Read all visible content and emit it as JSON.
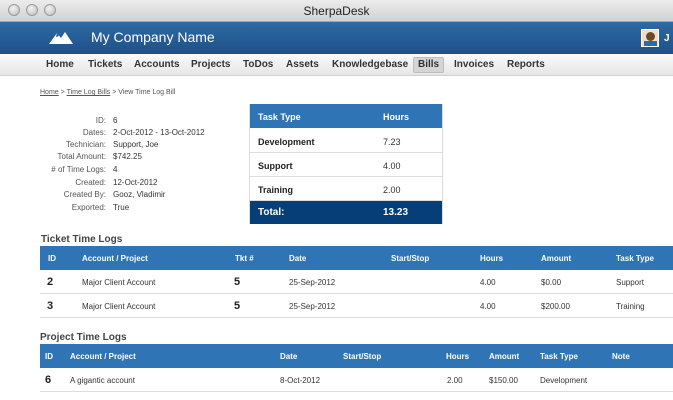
{
  "window": {
    "title": "SherpaDesk"
  },
  "header": {
    "company": "My Company Name",
    "user_initial": "J"
  },
  "nav": [
    "Home",
    "Tickets",
    "Accounts",
    "Projects",
    "ToDos",
    "Assets",
    "Knowledgebase",
    "Bills",
    "Invoices",
    "Reports"
  ],
  "nav_active": "Bills",
  "breadcrumb": {
    "home": "Home",
    "sep1": ">",
    "bills": "Time Log Bills",
    "sep2": ">",
    "current": "View Time Log Bill"
  },
  "details": [
    {
      "label": "ID:",
      "value": "6"
    },
    {
      "label": "Dates:",
      "value": "2-Oct-2012 - 13-Oct-2012"
    },
    {
      "label": "Technician:",
      "value": "Support, Joe"
    },
    {
      "label": "Total Amount:",
      "value": "$742.25"
    },
    {
      "label": "# of Time Logs:",
      "value": "4"
    },
    {
      "label": "Created:",
      "value": "12-Oct-2012"
    },
    {
      "label": "Created By:",
      "value": "Gooz, Vladimir"
    },
    {
      "label": "Exported:",
      "value": "True"
    }
  ],
  "summary": {
    "headers": {
      "type": "Task Type",
      "hours": "Hours"
    },
    "rows": [
      {
        "type": "Development",
        "hours": "7.23"
      },
      {
        "type": "Support",
        "hours": "4.00"
      },
      {
        "type": "Training",
        "hours": "2.00"
      }
    ],
    "total_label": "Total:",
    "total_hours": "13.23"
  },
  "ticket_logs": {
    "title": "Ticket Time Logs",
    "headers": {
      "id": "ID",
      "account": "Account / Project",
      "tkt": "Tkt #",
      "date": "Date",
      "startstop": "Start/Stop",
      "hours": "Hours",
      "amount": "Amount",
      "task": "Task Type"
    },
    "rows": [
      {
        "id": "2",
        "account": "Major Client Account",
        "tkt": "5",
        "date": "25-Sep-2012",
        "startstop": "",
        "hours": "4.00",
        "amount": "$0.00",
        "task": "Support"
      },
      {
        "id": "3",
        "account": "Major Client Account",
        "tkt": "5",
        "date": "25-Sep-2012",
        "startstop": "",
        "hours": "4.00",
        "amount": "$200.00",
        "task": "Training"
      }
    ]
  },
  "project_logs": {
    "title": "Project Time Logs",
    "headers": {
      "id": "ID",
      "account": "Account / Project",
      "date": "Date",
      "startstop": "Start/Stop",
      "hours": "Hours",
      "amount": "Amount",
      "task": "Task Type",
      "note": "Note"
    },
    "rows": [
      {
        "id": "6",
        "account": "A gigantic account",
        "date": "8-Oct-2012",
        "startstop": "",
        "hours": "2.00",
        "amount": "$150.00",
        "task": "Development",
        "note": ""
      }
    ]
  },
  "colors": {
    "header_blue": "#1d5088",
    "table_blue": "#2f75b5",
    "total_dark": "#063f78"
  }
}
